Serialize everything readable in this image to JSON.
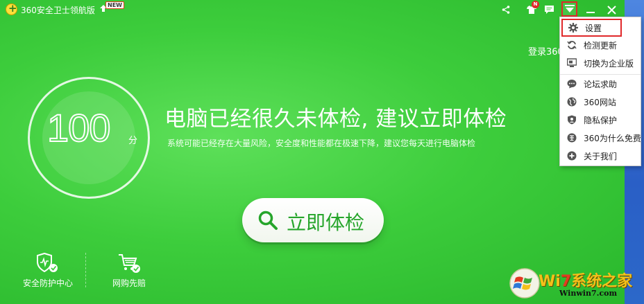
{
  "titlebar": {
    "app_title": "360安全卫士领航版",
    "new_badge": "NEW",
    "skin_badge": "N"
  },
  "score": {
    "value": "100",
    "unit": "分"
  },
  "headline": "电脑已经很久未体检, 建议立即体检",
  "subline": "系统可能已经存在大量风险，安全度和性能都在极速下降，建议您每天进行电脑体检",
  "login_text": "登录360",
  "check_button": {
    "label": "立即体检"
  },
  "shortcuts": [
    {
      "label": "安全防护中心",
      "icon": "shield-check-icon"
    },
    {
      "label": "网购先赔",
      "icon": "shopping-cart-icon"
    }
  ],
  "menu": {
    "items": [
      {
        "label": "设置",
        "icon": "gear-icon"
      },
      {
        "label": "检测更新",
        "icon": "refresh-icon"
      },
      {
        "label": "切换为企业版",
        "icon": "monitor-icon"
      },
      {
        "label": "论坛求助",
        "icon": "chat-bubble-icon"
      },
      {
        "label": "360网站",
        "icon": "globe-icon"
      },
      {
        "label": "隐私保护",
        "icon": "privacy-shield-icon"
      },
      {
        "label": "360为什么免费",
        "icon": "free-icon"
      },
      {
        "label": "关于我们",
        "icon": "plus-circle-icon"
      }
    ]
  },
  "watermark": {
    "brand_prefix": "Wi",
    "brand_seven": "7",
    "brand_suffix": "系统之家",
    "url": "Winwin7.com"
  },
  "colors": {
    "accent_green": "#3dcd3c",
    "highlight_red": "#e0282a",
    "button_text_green": "#26a52b"
  }
}
